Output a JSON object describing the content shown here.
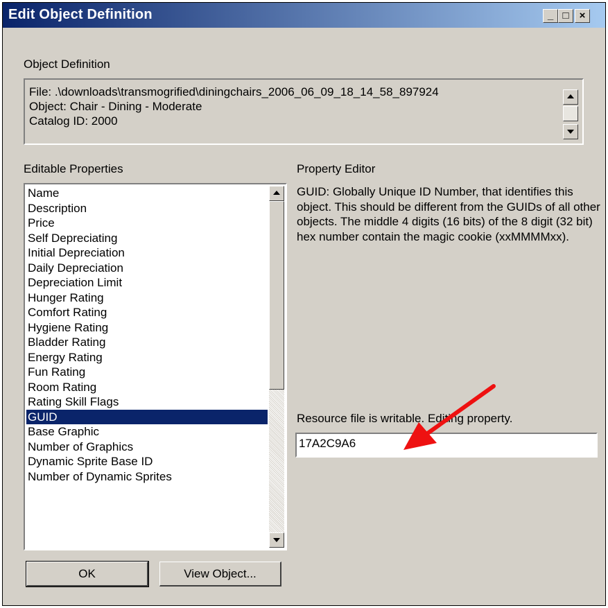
{
  "window": {
    "title": "Edit Object Definition",
    "minimize_glyph": "_",
    "maximize_glyph": "□",
    "close_glyph": "×"
  },
  "object_definition": {
    "label": "Object Definition",
    "lines": [
      "File: .\\downloads\\transmogrified\\diningchairs_2006_06_09_18_14_58_897924",
      "Object: Chair - Dining - Moderate",
      "Catalog ID: 2000"
    ]
  },
  "editable_properties": {
    "label": "Editable Properties",
    "items": [
      "Name",
      "Description",
      "Price",
      "Self Depreciating",
      "Initial Depreciation",
      "Daily Depreciation",
      "Depreciation Limit",
      "Hunger Rating",
      "Comfort Rating",
      "Hygiene Rating",
      "Bladder Rating",
      "Energy Rating",
      "Fun Rating",
      "Room Rating",
      "Rating Skill Flags",
      "GUID",
      "Base Graphic",
      "Number of Graphics",
      "Dynamic Sprite Base ID",
      "Number of Dynamic Sprites"
    ],
    "selected": "GUID"
  },
  "property_editor": {
    "label": "Property Editor",
    "description": "GUID: Globally Unique ID Number, that identifies this object. This should be different from the GUIDs of all other objects. The middle 4 digits (16 bits) of the 8 digit (32 bit) hex number contain the magic cookie (xxMMMMxx).",
    "status": "Resource file is writable. Editing property.",
    "value": "17A2C9A6"
  },
  "buttons": {
    "ok": "OK",
    "view_object": "View Object..."
  },
  "colors": {
    "annotation_arrow": "#ee1111",
    "selection": "#0a246a",
    "face": "#d4d0c8"
  },
  "icons": {
    "annotation": "red-arrow-icon"
  }
}
